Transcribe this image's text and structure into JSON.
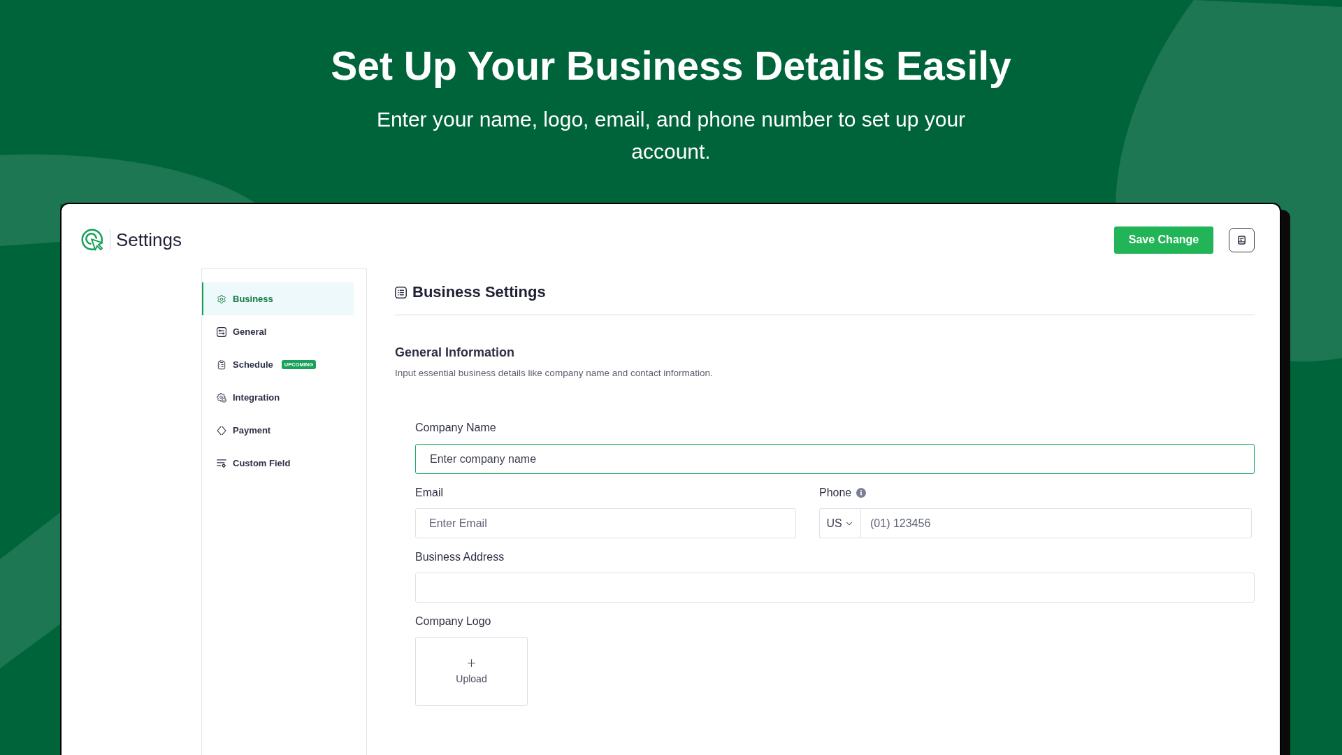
{
  "hero": {
    "title": "Set Up Your Business Details Easily",
    "subtitle": "Enter your name, logo, email, and phone number to set up your account."
  },
  "header": {
    "title": "Settings",
    "save_button": "Save Change"
  },
  "sidebar": {
    "items": [
      {
        "label": "Business",
        "selected": true
      },
      {
        "label": "General",
        "selected": false
      },
      {
        "label": "Schedule",
        "selected": false,
        "badge": "UPCOMING"
      },
      {
        "label": "Integration",
        "selected": false
      },
      {
        "label": "Payment",
        "selected": false
      },
      {
        "label": "Custom Field",
        "selected": false
      }
    ]
  },
  "content": {
    "title": "Business Settings",
    "section_title": "General Information",
    "section_description": "Input essential business details like company name and contact information.",
    "form": {
      "company_name": {
        "label": "Company Name",
        "placeholder": "Enter company name",
        "focused": true
      },
      "email": {
        "label": "Email",
        "placeholder": "Enter Email"
      },
      "phone": {
        "label": "Phone",
        "country": "US",
        "placeholder": "(01) 123456"
      },
      "business_address": {
        "label": "Business Address"
      },
      "company_logo": {
        "label": "Company Logo",
        "upload_button": "Upload"
      }
    }
  }
}
